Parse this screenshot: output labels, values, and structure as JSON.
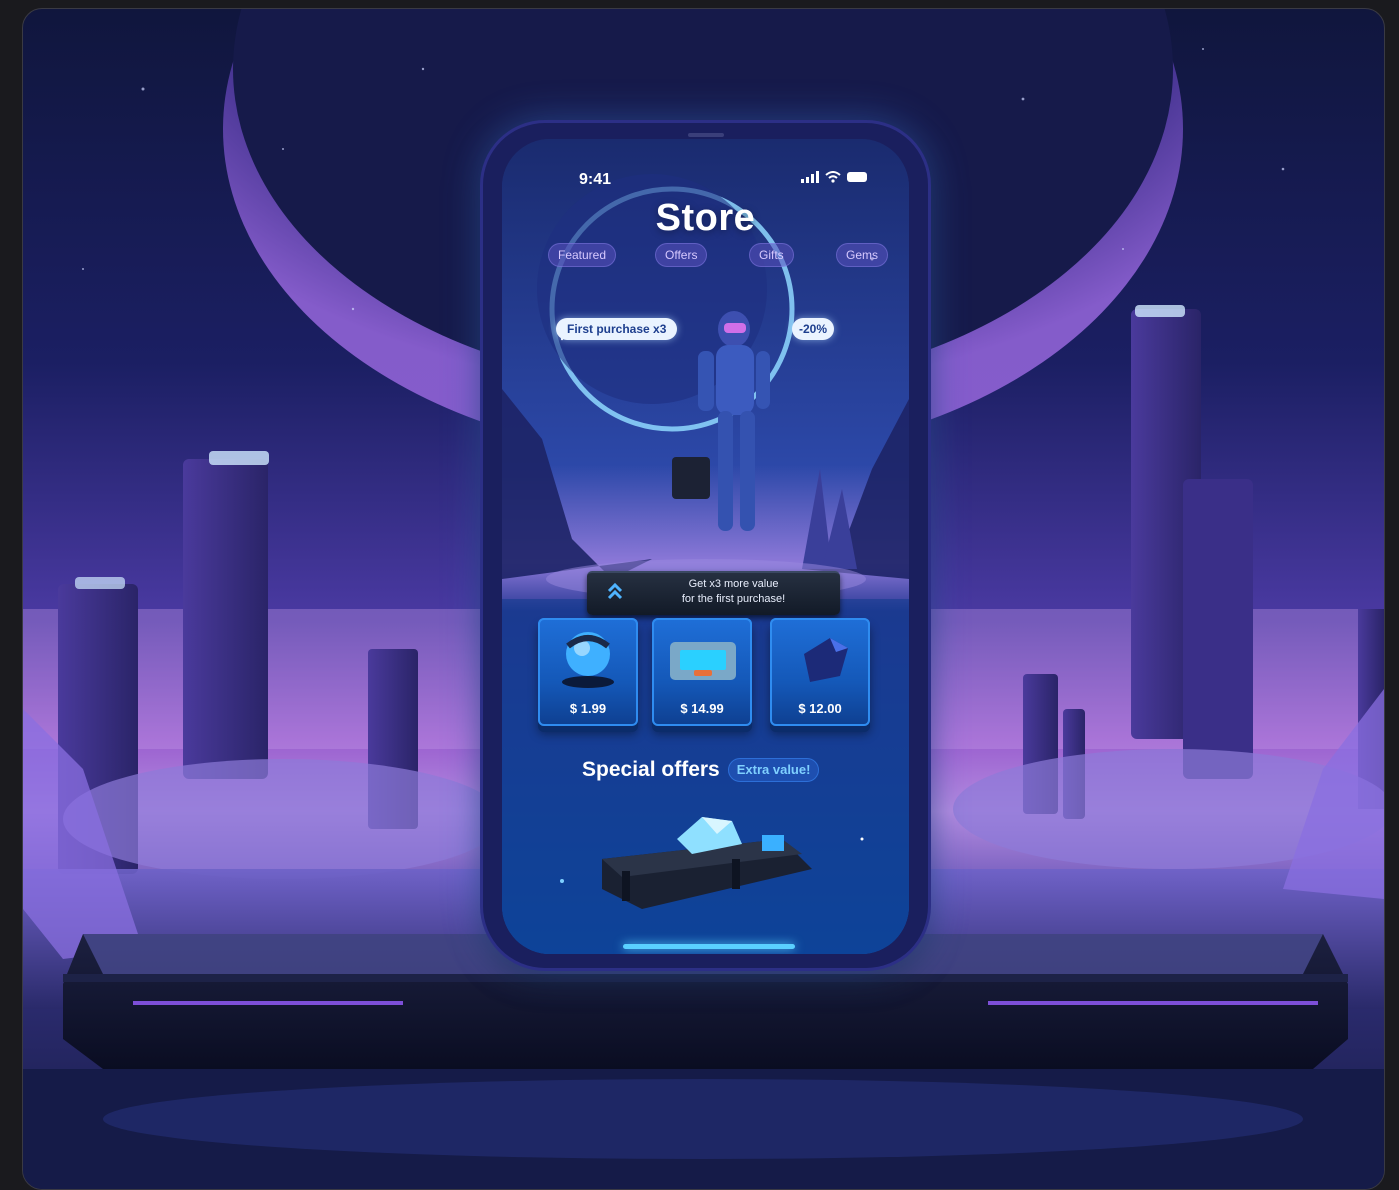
{
  "status_bar": {
    "time": "9:41"
  },
  "store": {
    "title": "Store",
    "tabs": [
      {
        "label": "Featured"
      },
      {
        "label": "Offers"
      },
      {
        "label": "Gifts"
      },
      {
        "label": "Gems"
      }
    ],
    "promo_pill": "First purchase x3",
    "discount_pill": "-20%",
    "banner": {
      "line1": "Get x3 more value",
      "line2": "for the first purchase!"
    },
    "items": [
      {
        "name": "helmet-orb",
        "price": "$ 1.99"
      },
      {
        "name": "tech-case",
        "price": "$ 14.99"
      },
      {
        "name": "dark-gem",
        "price": "$ 12.00"
      }
    ],
    "special_offers": {
      "title": "Special offers",
      "badge": "Extra value!"
    }
  },
  "colors": {
    "accent": "#2f8cf0",
    "badge_text": "#7fd0ff",
    "pill_bg": "#eaf3ff",
    "tab_bg": "#5a50be"
  }
}
